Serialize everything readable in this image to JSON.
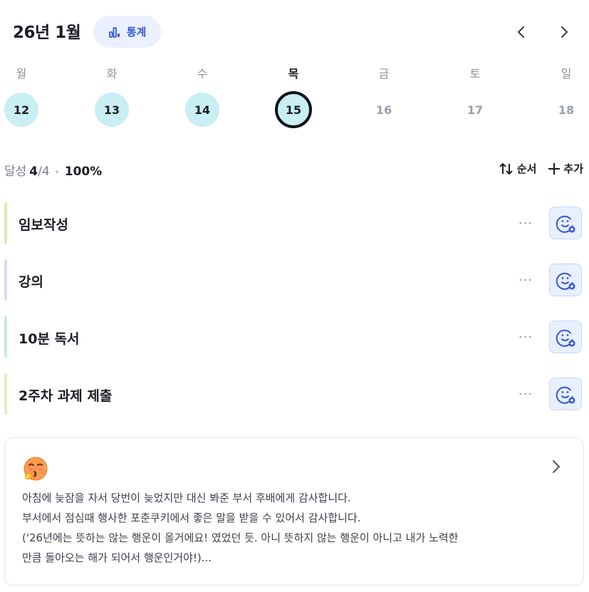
{
  "header": {
    "month_title": "26년 1월",
    "stats_label": "통계",
    "accent_color": "#3457d5",
    "prev_icon": "chevron-left-icon",
    "next_icon": "chevron-right-icon"
  },
  "week": {
    "days": [
      {
        "label": "월",
        "date": "12",
        "state": "done"
      },
      {
        "label": "화",
        "date": "13",
        "state": "done"
      },
      {
        "label": "수",
        "date": "14",
        "state": "done"
      },
      {
        "label": "목",
        "date": "15",
        "state": "today"
      },
      {
        "label": "금",
        "date": "16",
        "state": "none"
      },
      {
        "label": "토",
        "date": "17",
        "state": "none"
      },
      {
        "label": "일",
        "date": "18",
        "state": "none"
      }
    ]
  },
  "summary": {
    "label": "달성",
    "count": "4",
    "separator": "/4",
    "percent": "100%"
  },
  "toolbar": {
    "order_label": "순서",
    "add_label": "추가"
  },
  "tasks": [
    {
      "name": "임보작성",
      "color": "#d9ecb4"
    },
    {
      "name": "강의",
      "color": "#d2dbf4"
    },
    {
      "name": "10분 독서",
      "color": "#c8ecd9"
    },
    {
      "name": "2주차 과제 제출",
      "color": "#e0efc2"
    }
  ],
  "task_more_label": "···",
  "journal": {
    "emoji": "kissing-face-icon",
    "lines": [
      "아침에 늦잠을 자서 당번이 늦었지만 대신 봐준 부서 후배에게 감사합니다.",
      "부서에서 점심때 행사한 포춘쿠키에서 좋은 말을 받을 수 있어서 감사합니다.",
      "('26년에는 뜻하는 않는 행운이 올거에요! 였었던 듯. 아니 뜻하지 않는 행운이 아니고 내가 노력한",
      "만큼 돌아오는 해가 되어서 행운인거야!)..."
    ]
  }
}
